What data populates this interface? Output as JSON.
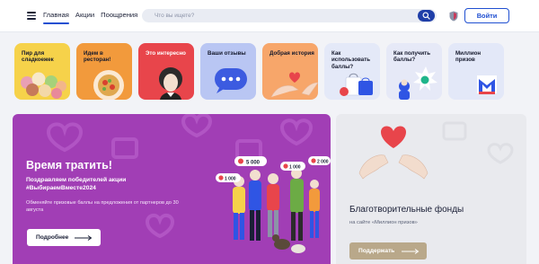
{
  "header": {
    "nav": [
      {
        "label": "Главная",
        "active": true
      },
      {
        "label": "Акции",
        "active": false
      },
      {
        "label": "Поощрения",
        "active": false
      }
    ],
    "search_placeholder": "Что вы ищете?",
    "login_label": "Войти"
  },
  "stories": [
    {
      "label": "Пир для сладкоежек",
      "bg": "#f6d24a"
    },
    {
      "label": "Идем в ресторан!",
      "bg": "#f29a3c"
    },
    {
      "label": "Это интересно",
      "bg": "#e8454b"
    },
    {
      "label": "Ваши отзывы",
      "bg": "#b9c6f3"
    },
    {
      "label": "Добрая история",
      "bg": "#f7a66a"
    },
    {
      "label": "Как использовать баллы?",
      "bg": "#e4e9f8"
    },
    {
      "label": "Как получить баллы?",
      "bg": "#e6e9f7"
    },
    {
      "label": "Миллион призов",
      "bg": "#e3e8f8"
    }
  ],
  "main_banner": {
    "title": "Время тратить!",
    "subtitle": "Поздравляем победителей акции #ВыбираемВместе2024",
    "text": "Обменяйте призовые баллы на предложения от партнеров до 30 августа",
    "button": "Подробнее",
    "points_badges": [
      "5 000",
      "1 000",
      "2 000",
      "1 000"
    ],
    "bg": "#a13eb5"
  },
  "side_banner": {
    "title": "Благотворительные фонды",
    "subtitle": "на сайте «Миллион призов»",
    "button": "Поддержать",
    "heart_color": "#e8454b"
  }
}
